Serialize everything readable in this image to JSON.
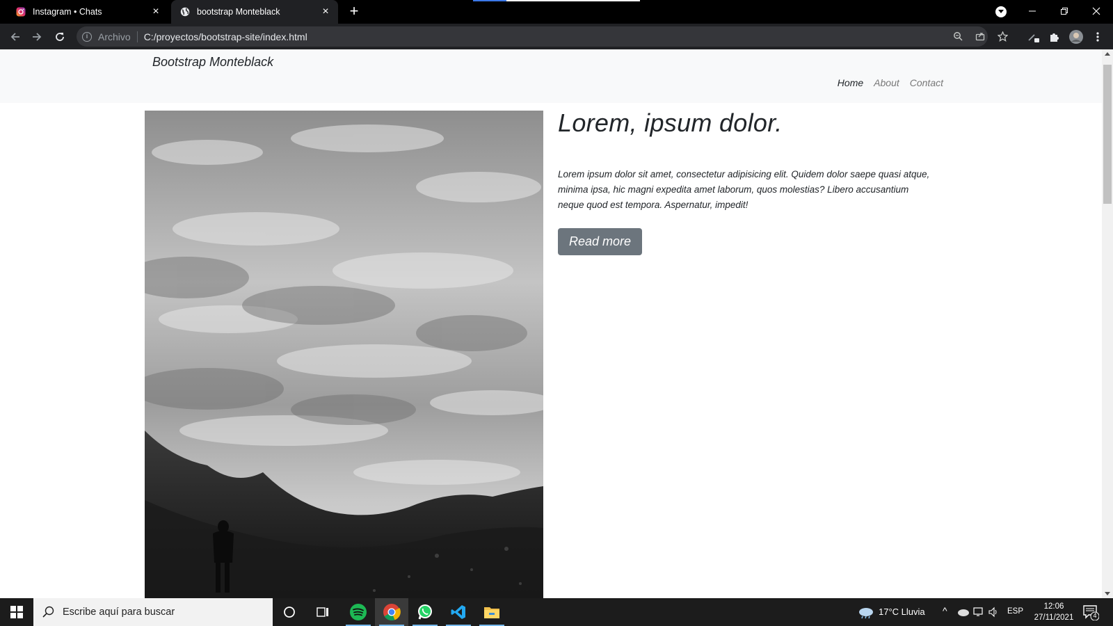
{
  "browser": {
    "tabs": [
      {
        "title": "Instagram • Chats",
        "icon": "instagram-icon",
        "active": false
      },
      {
        "title": "bootstrap Monteblack",
        "icon": "globe-icon",
        "active": true
      }
    ],
    "address_scheme": "Archivo",
    "address_url": "C:/proyectos/bootstrap-site/index.html"
  },
  "site": {
    "brand": "Bootstrap Monteblack",
    "nav": [
      {
        "label": "Home",
        "active": true
      },
      {
        "label": "About",
        "active": false
      },
      {
        "label": "Contact",
        "active": false
      }
    ],
    "headline": "Lorem, ipsum dolor.",
    "paragraph": "Lorem ipsum dolor sit amet, consectetur adipisicing elit. Quidem dolor saepe quasi atque, minima ipsa, hic magni expedita amet laborum, quos molestias? Libero accusantium neque quod est tempora. Aspernatur, impedit!",
    "button_label": "Read more",
    "image_icon": "landscape-photo"
  },
  "taskbar": {
    "search_placeholder": "Escribe aquí para buscar",
    "weather": "17°C  Lluvia",
    "language": "ESP",
    "time": "12:06",
    "date": "27/11/2021",
    "notification_count": "4",
    "apps": [
      "cortana-icon",
      "task-view-icon",
      "spotify-icon",
      "chrome-icon",
      "whatsapp-icon",
      "vscode-icon",
      "file-explorer-icon"
    ]
  },
  "colors": {
    "tabstrip": "#000000",
    "toolbar": "#202124",
    "navbar_bg": "#f8f9fa",
    "button_bg": "#6c757d",
    "taskbar_bg": "#1c1c1c"
  }
}
